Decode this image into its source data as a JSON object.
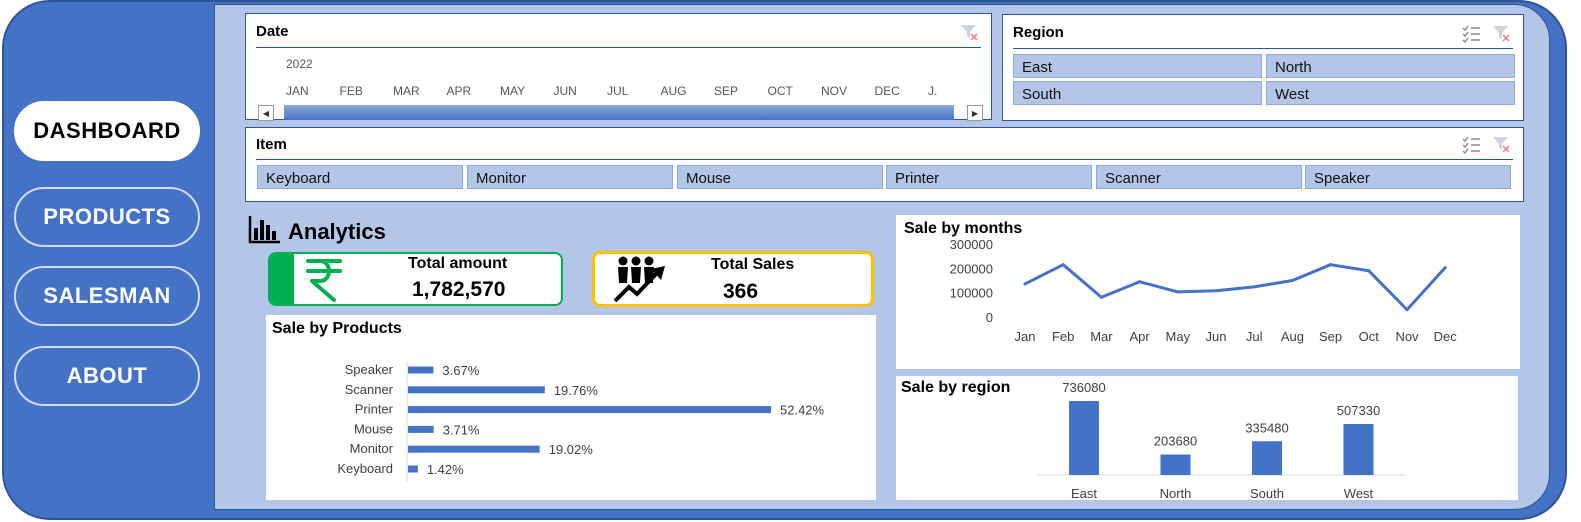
{
  "nav": {
    "items": [
      {
        "label": "DASHBOARD",
        "active": true
      },
      {
        "label": "PRODUCTS",
        "active": false
      },
      {
        "label": "SALESMAN",
        "active": false
      },
      {
        "label": "ABOUT",
        "active": false
      }
    ]
  },
  "date_slicer": {
    "title": "Date",
    "year": "2022",
    "months": [
      "JAN",
      "FEB",
      "MAR",
      "APR",
      "MAY",
      "JUN",
      "JUL",
      "AUG",
      "SEP",
      "OCT",
      "NOV",
      "DEC",
      "J."
    ]
  },
  "region_slicer": {
    "title": "Region",
    "items": [
      "East",
      "North",
      "South",
      "West"
    ]
  },
  "item_slicer": {
    "title": "Item",
    "items": [
      "Keyboard",
      "Monitor",
      "Mouse",
      "Printer",
      "Scanner",
      "Speaker"
    ]
  },
  "analytics": {
    "title": "Analytics"
  },
  "kpis": {
    "total_amount": {
      "label": "Total amount",
      "value": "1,782,570",
      "icon": "rupee-icon"
    },
    "total_sales": {
      "label": "Total Sales",
      "value": "366",
      "icon": "people-growth-icon"
    }
  },
  "colors": {
    "frame": "#4472c4",
    "panel_bg": "#b4c6e7",
    "series": "#4472c4",
    "amount_accent": "#00b050",
    "sales_accent": "#ffc000"
  },
  "chart_data": [
    {
      "type": "bar",
      "orientation": "horizontal",
      "title": "Sale by Products",
      "categories": [
        "Speaker",
        "Scanner",
        "Printer",
        "Mouse",
        "Monitor",
        "Keyboard"
      ],
      "values": [
        3.67,
        19.76,
        52.42,
        3.71,
        19.02,
        1.42
      ],
      "data_labels": [
        "3.67%",
        "19.76%",
        "52.42%",
        "3.71%",
        "19.02%",
        "1.42%"
      ],
      "unit": "%"
    },
    {
      "type": "line",
      "title": "Sale by months",
      "x": [
        "Jan",
        "Feb",
        "Mar",
        "Apr",
        "May",
        "Jun",
        "Jul",
        "Aug",
        "Sep",
        "Oct",
        "Nov",
        "Dec"
      ],
      "values": [
        136000,
        215000,
        81000,
        145000,
        103000,
        108000,
        124000,
        150000,
        215000,
        190000,
        30000,
        203000
      ],
      "ylim": [
        0,
        300000
      ],
      "yticks": [
        "300000",
        "200000",
        "100000",
        "0"
      ]
    },
    {
      "type": "bar",
      "title": "Sale by region",
      "categories": [
        "East",
        "North",
        "South",
        "West"
      ],
      "values": [
        736080,
        203680,
        335480,
        507330
      ],
      "data_labels": [
        "736080",
        "203680",
        "335480",
        "507330"
      ]
    }
  ]
}
